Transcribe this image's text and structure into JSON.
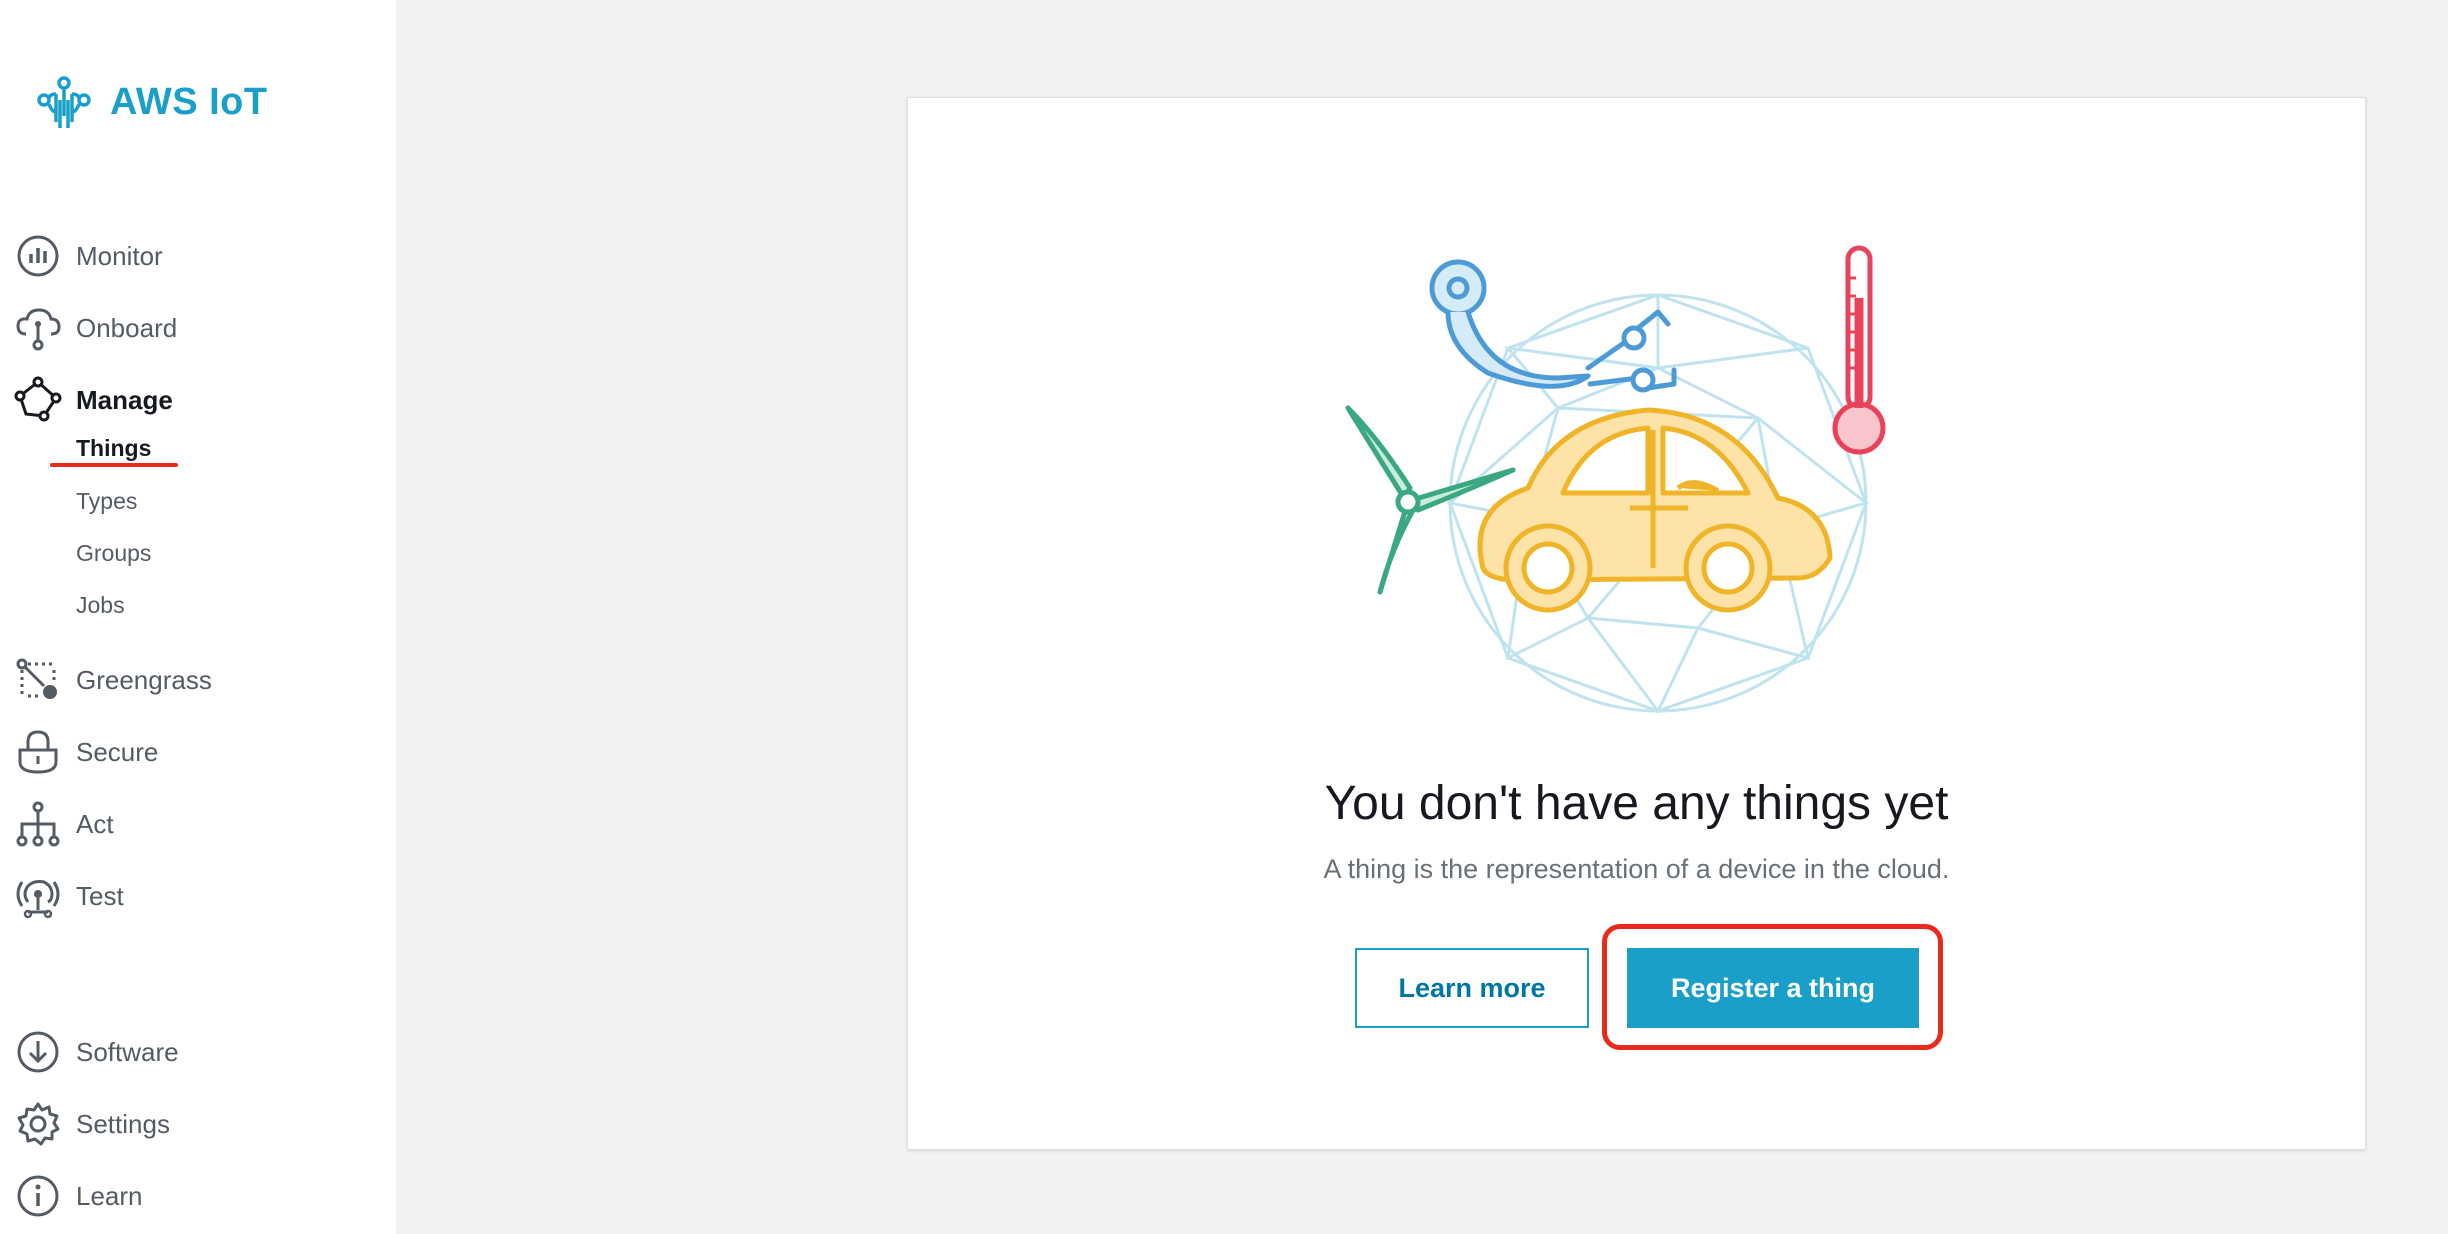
{
  "app": {
    "title": "AWS IoT",
    "logo_icon": "aws-iot-logo-icon",
    "accent_color": "#1a9fc9",
    "highlight_color": "#e8291c"
  },
  "sidebar": {
    "monitor": {
      "label": "Monitor",
      "icon": "chart-icon"
    },
    "onboard": {
      "label": "Onboard",
      "icon": "cloud-icon"
    },
    "manage": {
      "label": "Manage",
      "icon": "nodes-icon",
      "subitems": {
        "things": "Things",
        "types": "Types",
        "groups": "Groups",
        "jobs": "Jobs"
      }
    },
    "greengrass": {
      "label": "Greengrass",
      "icon": "greengrass-icon"
    },
    "secure": {
      "label": "Secure",
      "icon": "lock-icon"
    },
    "act": {
      "label": "Act",
      "icon": "act-icon"
    },
    "test": {
      "label": "Test",
      "icon": "test-icon"
    },
    "software": {
      "label": "Software",
      "icon": "download-icon"
    },
    "settings": {
      "label": "Settings",
      "icon": "gear-icon"
    },
    "learn": {
      "label": "Learn",
      "icon": "info-icon"
    }
  },
  "main": {
    "empty_state": {
      "title": "You don't have any things yet",
      "description": "A thing is the representation of a device in the cloud.",
      "learn_more_label": "Learn more",
      "register_label": "Register a thing"
    }
  }
}
